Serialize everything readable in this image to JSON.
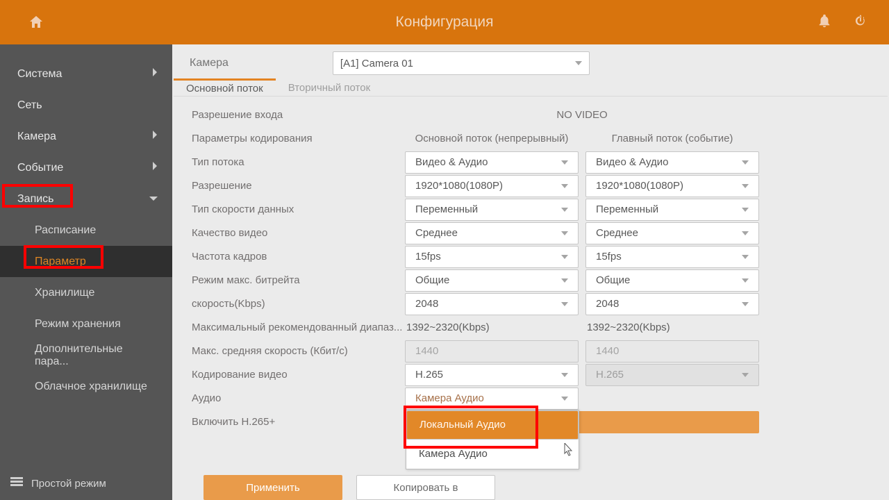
{
  "header": {
    "title": "Конфигурация"
  },
  "sidebar": {
    "items": [
      {
        "label": "Система",
        "hasChildren": true
      },
      {
        "label": "Сеть",
        "hasChildren": false
      },
      {
        "label": "Камера",
        "hasChildren": true
      },
      {
        "label": "Событие",
        "hasChildren": true
      },
      {
        "label": "Запись",
        "hasChildren": true,
        "expanded": true
      },
      {
        "label": "Расписание"
      },
      {
        "label": "Параметр",
        "active": true
      },
      {
        "label": "Хранилище"
      },
      {
        "label": "Режим хранения"
      },
      {
        "label": "Дополнительные пара..."
      },
      {
        "label": "Облачное хранилище"
      }
    ],
    "footer": "Простой режим"
  },
  "toprow": {
    "camera_label": "Камера",
    "camera_value": "[A1] Camera 01"
  },
  "tabs": [
    {
      "label": "Основной поток",
      "active": true
    },
    {
      "label": "Вторичный поток"
    }
  ],
  "cols": {
    "c1": "Основной поток (непрерывный)",
    "c2": "Главный поток (событие)"
  },
  "rows": {
    "r1": {
      "label": "Разрешение входа",
      "v": "NO VIDEO"
    },
    "r2": {
      "label": "Параметры кодирования"
    },
    "r3": {
      "label": "Тип потока",
      "a": "Видео & Аудио",
      "b": "Видео & Аудио"
    },
    "r4": {
      "label": "Разрешение",
      "a": "1920*1080(1080P)",
      "b": "1920*1080(1080P)"
    },
    "r5": {
      "label": "Тип скорости данных",
      "a": "Переменный",
      "b": "Переменный"
    },
    "r6": {
      "label": "Качество видео",
      "a": "Среднее",
      "b": "Среднее"
    },
    "r7": {
      "label": "Частота кадров",
      "a": "15fps",
      "b": "15fps"
    },
    "r8": {
      "label": "Режим макс. битрейта",
      "a": "Общие",
      "b": "Общие"
    },
    "r9": {
      "label": "скорость(Kbps)",
      "a": "2048",
      "b": "2048"
    },
    "r10": {
      "label": "Максимальный рекомендованный диапаз...",
      "a": "1392~2320(Kbps)",
      "b": "1392~2320(Kbps)"
    },
    "r11": {
      "label": "Макс. средняя скорость (Кбит/с)",
      "a": "1440",
      "b": "1440"
    },
    "r12": {
      "label": "Кодирование видео",
      "a": "H.265",
      "b": "H.265"
    },
    "r13": {
      "label": "Аудио",
      "a": "Камера Аудио"
    },
    "r14": {
      "label": "Включить H.265+"
    }
  },
  "dropdown": {
    "opt1": "Локальный Аудио",
    "opt2": "Камера Аудио"
  },
  "buttons": {
    "apply": "Применить",
    "copy": "Копировать в"
  }
}
